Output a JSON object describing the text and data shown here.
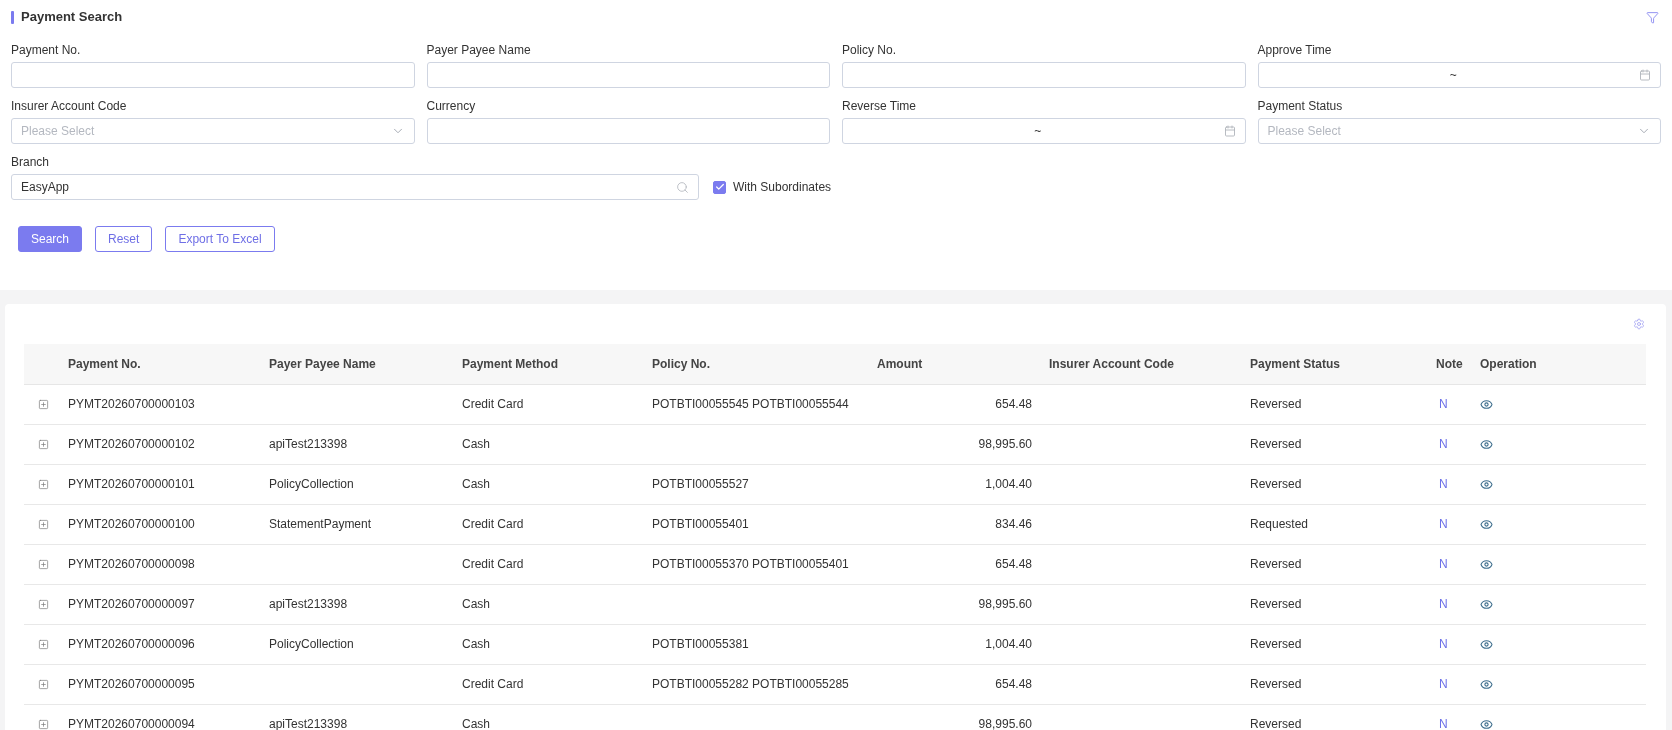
{
  "search_panel": {
    "title": "Payment Search",
    "fields": [
      {
        "kind": "text",
        "label": "Payment No."
      },
      {
        "kind": "text",
        "label": "Payer Payee Name"
      },
      {
        "kind": "text",
        "label": "Policy No."
      },
      {
        "kind": "date_range",
        "label": "Approve Time",
        "separator": "~"
      },
      {
        "kind": "select",
        "label": "Insurer Account Code",
        "placeholder": "Please Select"
      },
      {
        "kind": "text",
        "label": "Currency"
      },
      {
        "kind": "date_range",
        "label": "Reverse Time",
        "separator": "~"
      },
      {
        "kind": "select",
        "label": "Payment Status",
        "placeholder": "Please Select"
      }
    ],
    "branch": {
      "label": "Branch",
      "value": "EasyApp"
    },
    "with_subordinates": {
      "label": "With Subordinates",
      "checked": true
    },
    "buttons": [
      {
        "kind": "primary",
        "label": "Search"
      },
      {
        "kind": "outline",
        "label": "Reset"
      },
      {
        "kind": "outline",
        "label": "Export To Excel"
      }
    ]
  },
  "table": {
    "columns": [
      "Payment No.",
      "Payer Payee Name",
      "Payment Method",
      "Policy No.",
      "Amount",
      "Insurer Account Code",
      "Payment Status",
      "Note",
      "Operation"
    ],
    "rows": [
      {
        "expanded": false,
        "payment_no": "PYMT20260700000103",
        "payment_method": "Credit Card",
        "policy_no": "POTBTI00055545 POTBTI00055544",
        "amount": "654.48",
        "payment_status": "Reversed",
        "note": "N"
      },
      {
        "expanded": false,
        "payment_no": "PYMT20260700000102",
        "payer_payee_name": "apiTest213398",
        "payment_method": "Cash",
        "amount": "98,995.60",
        "payment_status": "Reversed",
        "note": "N"
      },
      {
        "expanded": false,
        "payment_no": "PYMT20260700000101",
        "payer_payee_name": "PolicyCollection",
        "payment_method": "Cash",
        "policy_no": "POTBTI00055527",
        "amount": "1,004.40",
        "payment_status": "Reversed",
        "note": "N"
      },
      {
        "expanded": false,
        "payment_no": "PYMT20260700000100",
        "payer_payee_name": "StatementPayment",
        "payment_method": "Credit Card",
        "policy_no": "POTBTI00055401",
        "amount": "834.46",
        "payment_status": "Requested",
        "note": "N"
      },
      {
        "expanded": false,
        "payment_no": "PYMT20260700000098",
        "payment_method": "Credit Card",
        "policy_no": "POTBTI00055370 POTBTI00055401",
        "amount": "654.48",
        "payment_status": "Reversed",
        "note": "N"
      },
      {
        "expanded": false,
        "payment_no": "PYMT20260700000097",
        "payer_payee_name": "apiTest213398",
        "payment_method": "Cash",
        "amount": "98,995.60",
        "payment_status": "Reversed",
        "note": "N"
      },
      {
        "expanded": false,
        "payment_no": "PYMT20260700000096",
        "payer_payee_name": "PolicyCollection",
        "payment_method": "Cash",
        "policy_no": "POTBTI00055381",
        "amount": "1,004.40",
        "payment_status": "Reversed",
        "note": "N"
      },
      {
        "expanded": false,
        "payment_no": "PYMT20260700000095",
        "payment_method": "Credit Card",
        "policy_no": "POTBTI00055282 POTBTI00055285",
        "amount": "654.48",
        "payment_status": "Reversed",
        "note": "N"
      },
      {
        "expanded": false,
        "payment_no": "PYMT20260700000094",
        "payer_payee_name": "apiTest213398",
        "payment_method": "Cash",
        "amount": "98,995.60",
        "payment_status": "Reversed",
        "note": "N"
      }
    ]
  }
}
